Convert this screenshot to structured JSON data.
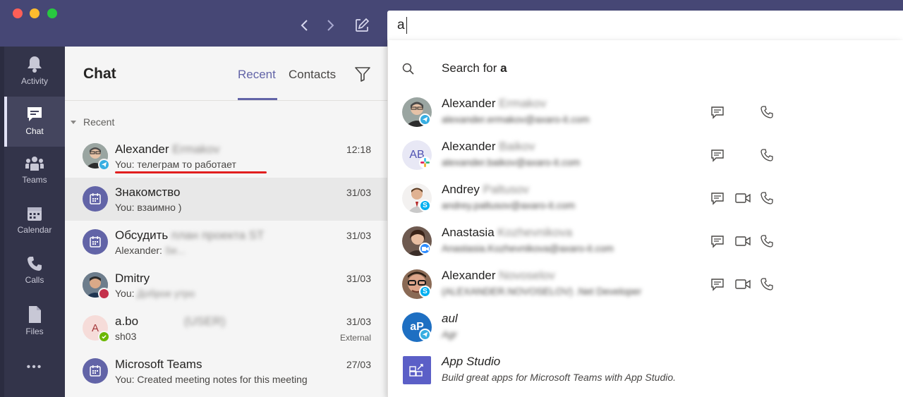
{
  "search": {
    "value": "a"
  },
  "rail": {
    "items": [
      {
        "label": "Activity",
        "icon": "bell-icon"
      },
      {
        "label": "Chat",
        "icon": "chat-icon"
      },
      {
        "label": "Teams",
        "icon": "teams-icon"
      },
      {
        "label": "Calendar",
        "icon": "calendar-icon"
      },
      {
        "label": "Calls",
        "icon": "phone-icon"
      },
      {
        "label": "Files",
        "icon": "file-icon"
      }
    ],
    "more": "•••"
  },
  "chat": {
    "title": "Chat",
    "tabs": [
      "Recent",
      "Contacts"
    ],
    "section": "Recent",
    "rows": [
      {
        "name_first": "Alexander",
        "name_rest": "Ermakov",
        "preview": "You: телеграм то работает",
        "time": "12:18"
      },
      {
        "name_first": "Знакомство",
        "name_rest": "",
        "preview": "You: взаимно )",
        "time": "31/03"
      },
      {
        "name_first": "Обсудить",
        "name_rest": "план проекта ST",
        "preview": "Alexander:",
        "preview_rest": "Se...",
        "time": "31/03"
      },
      {
        "name_first": "Dmitry",
        "name_rest": "",
        "preview": "You:",
        "preview_rest": "Доброе утро",
        "time": "31/03"
      },
      {
        "name_first": "a.bo",
        "name_rest": "(USER)",
        "preview": "sh03",
        "time": "31/03",
        "extra": "External",
        "initial": "A"
      },
      {
        "name_first": "Microsoft Teams",
        "name_rest": "",
        "preview": "You: Created meeting notes for this meeting",
        "time": "27/03"
      }
    ]
  },
  "dropdown": {
    "search_prefix": "Search for ",
    "search_term": "a",
    "results": [
      {
        "name_first": "Alexander",
        "name_rest": "Ermakov",
        "sub": "alexander.ermakov@axaro-it.com",
        "actions": [
          "chat",
          "call"
        ]
      },
      {
        "name_first": "Alexander",
        "name_rest": "Baikov",
        "sub": "alexander.baikov@axaro-it.com",
        "initials": "AB",
        "actions": [
          "chat",
          "call"
        ]
      },
      {
        "name_first": "Andrey",
        "name_rest": "Paltusov",
        "sub": "andrey.paltusov@axaro-it.com",
        "actions": [
          "chat",
          "video",
          "call"
        ]
      },
      {
        "name_first": "Anastasia",
        "name_rest": "Kozhevnikova",
        "sub": "Anastasia.Kozhevnikova@axaro-it.com",
        "actions": [
          "chat",
          "video",
          "call"
        ]
      },
      {
        "name_first": "Alexander",
        "name_rest": "Novoselov",
        "sub": "(ALEXANDER.NOVOSELOV) .Net Developer",
        "actions": [
          "chat",
          "video",
          "call"
        ]
      },
      {
        "name_first": "aul",
        "name_rest": "",
        "sub": "Agr",
        "initials": "aP"
      },
      {
        "name_first": "App Studio",
        "name_rest": "",
        "sub": "Build great apps for Microsoft Teams with App Studio."
      }
    ]
  },
  "colors": {
    "titlebar": "#464775",
    "rail": "#33344a",
    "accent": "#6264a7",
    "annotation": "#e11f1f"
  }
}
